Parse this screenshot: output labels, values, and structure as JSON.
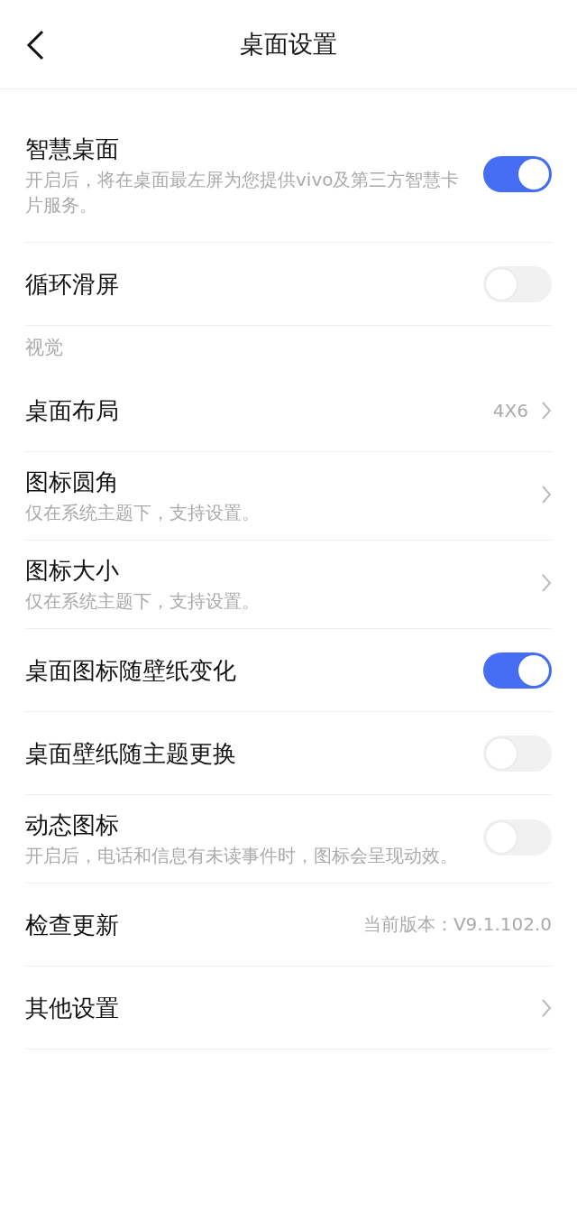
{
  "header": {
    "title": "桌面设置"
  },
  "items": [
    {
      "kind": "toggle",
      "title": "智慧桌面",
      "description": "开启后，将在桌面最左屏为您提供vivo及第三方智慧卡片服务。",
      "on": true
    },
    {
      "kind": "toggle",
      "title": "循环滑屏",
      "on": false
    },
    {
      "kind": "section",
      "title": "视觉"
    },
    {
      "kind": "link",
      "title": "桌面布局",
      "value": "4X6"
    },
    {
      "kind": "link",
      "title": "图标圆角",
      "description": "仅在系统主题下，支持设置。"
    },
    {
      "kind": "link",
      "title": "图标大小",
      "description": "仅在系统主题下，支持设置。"
    },
    {
      "kind": "toggle",
      "title": "桌面图标随壁纸变化",
      "on": true
    },
    {
      "kind": "toggle",
      "title": "桌面壁纸随主题更换",
      "on": false
    },
    {
      "kind": "toggle",
      "title": "动态图标",
      "description": "开启后，电话和信息有未读事件时，图标会呈现动效。",
      "on": false
    },
    {
      "kind": "info",
      "title": "检查更新",
      "value": "当前版本：V9.1.102.0"
    },
    {
      "kind": "link",
      "title": "其他设置"
    }
  ]
}
